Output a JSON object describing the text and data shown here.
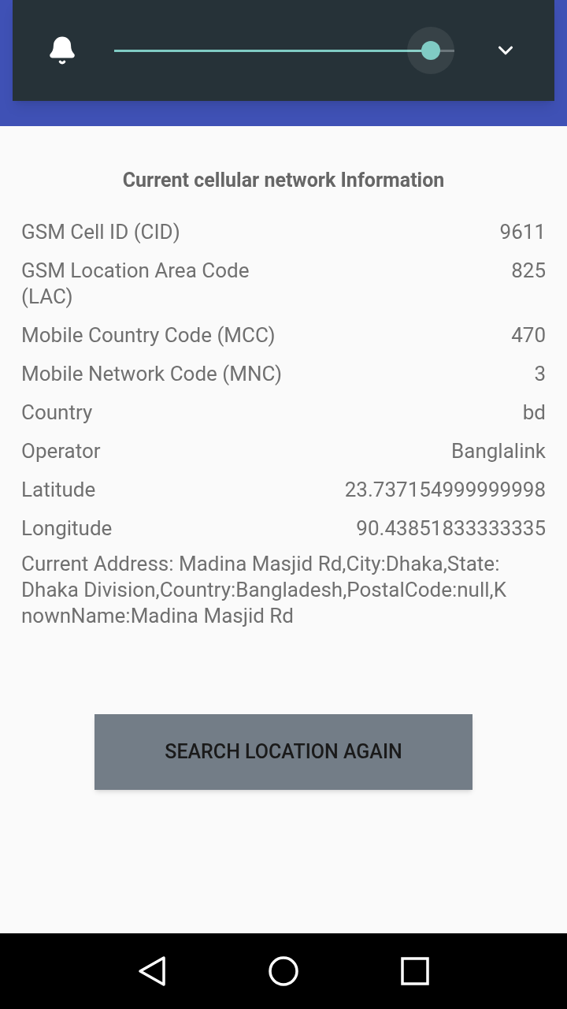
{
  "volume_panel": {
    "level": 0.93
  },
  "title": "Current cellular network Information",
  "rows": [
    {
      "label": "GSM Cell ID (CID)",
      "value": "9611"
    },
    {
      "label": "GSM Location Area Code (LAC)",
      "value": "825"
    },
    {
      "label": "Mobile Country Code (MCC)",
      "value": "470"
    },
    {
      "label": "Mobile Network Code (MNC)",
      "value": "3"
    },
    {
      "label": "Country",
      "value": "bd"
    },
    {
      "label": "Operator",
      "value": "Banglalink"
    },
    {
      "label": "Latitude",
      "value": "23.737154999999998"
    },
    {
      "label": "Longitude",
      "value": "90.43851833333335"
    }
  ],
  "address": "Current Address: Madina Masjid Rd,City:Dhaka,State:Dhaka Division,Country:Bangladesh,PostalCode:null,KnownName:Madina Masjid Rd",
  "button": "SEARCH LOCATION AGAIN"
}
